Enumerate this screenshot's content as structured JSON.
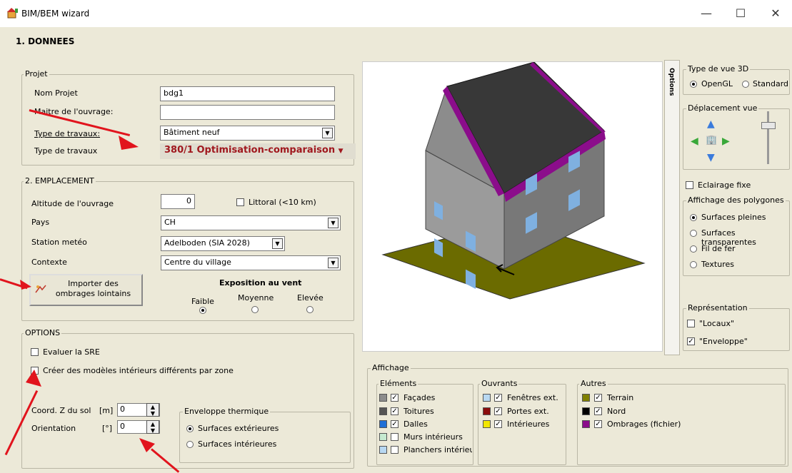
{
  "window": {
    "title": "BIM/BEM wizard",
    "minimize": "—",
    "maximize": "☐",
    "close": "✕"
  },
  "section": "1.   DONNEES",
  "projet": {
    "legend": "Projet",
    "nom_label": "Nom Projet",
    "nom_value": "bdg1",
    "maitre_label": "Maitre de l'ouvrage:",
    "maitre_value": "",
    "type_travaux_label": "Type de travaux:",
    "type_travaux_value": "Bâtiment neuf",
    "type_travaux2_label": "Type de travaux",
    "type_travaux2_value": "380/1 Optimisation-comparaison"
  },
  "emplacement": {
    "legend": "2. EMPLACEMENT",
    "altitude_label": "Altitude de l'ouvrage",
    "altitude_value": "0",
    "littoral_label": "Littoral (<10 km)",
    "pays_label": "Pays",
    "pays_value": "CH",
    "station_label": "Station metéo",
    "station_value": "Adelboden (SIA 2028)",
    "contexte_label": "Contexte",
    "contexte_value": "Centre du village",
    "importer_label": "Importer des ombrages lointains",
    "exposition_label": "Exposition au vent",
    "faible": "Faible",
    "moyenne": "Moyenne",
    "elevee": "Elevée"
  },
  "options": {
    "legend": "OPTIONS",
    "sre_label": "Evaluer la SRE",
    "modeles_label": "Créer des modèles intérieurs différents par zone",
    "coordz_label": "Coord. Z du sol",
    "coordz_unit": "[m]",
    "coordz_value": "0",
    "orientation_label": "Orientation",
    "orientation_unit": "[°]",
    "orientation_value": "0",
    "enveloppe_legend": "Enveloppe thermique",
    "surf_ext": "Surfaces extérieures",
    "surf_int": "Surfaces intérieures"
  },
  "right_panel": {
    "tab": "Options",
    "vue_legend": "Type de vue 3D",
    "opengl": "OpenGL",
    "standard": "Standard",
    "deplacement_legend": "Déplacement vue",
    "eclairage": "Eclairage fixe",
    "polygones_legend": "Affichage des polygones",
    "surfaces_pleines": "Surfaces pleines",
    "surfaces_transp": "Surfaces transparentes",
    "fil_de_fer": "Fil de fer",
    "textures": "Textures",
    "representation_legend": "Représentation",
    "locaux": "\"Locaux\"",
    "enveloppe": "\"Enveloppe\""
  },
  "affichage": {
    "legend": "Affichage",
    "elements_legend": "Eléments",
    "elements": [
      "Façades",
      "Toitures",
      "Dalles",
      "Murs intérieurs",
      "Planchers intérieu"
    ],
    "ouvrants_legend": "Ouvrants",
    "ouvrants": [
      "Fenêtres ext.",
      "Portes ext.",
      "Intérieures"
    ],
    "autres_legend": "Autres",
    "autres": [
      "Terrain",
      "Nord",
      "Ombrages (fichier)"
    ]
  },
  "colors": {
    "accent_red": "#e1141d",
    "type_travaux_text": "#a0181e",
    "roof": "#3a3a3a",
    "roof_edge": "#8b0d8b",
    "wall": "#8c8c8c",
    "ground": "#808000",
    "window": "#7fb0e0"
  },
  "icons": [
    "app-icon",
    "arrow-up-icon",
    "arrow-left-icon",
    "arrow-right-icon",
    "arrow-down-icon",
    "building-icon",
    "import-icon",
    "north-arrow-icon"
  ]
}
